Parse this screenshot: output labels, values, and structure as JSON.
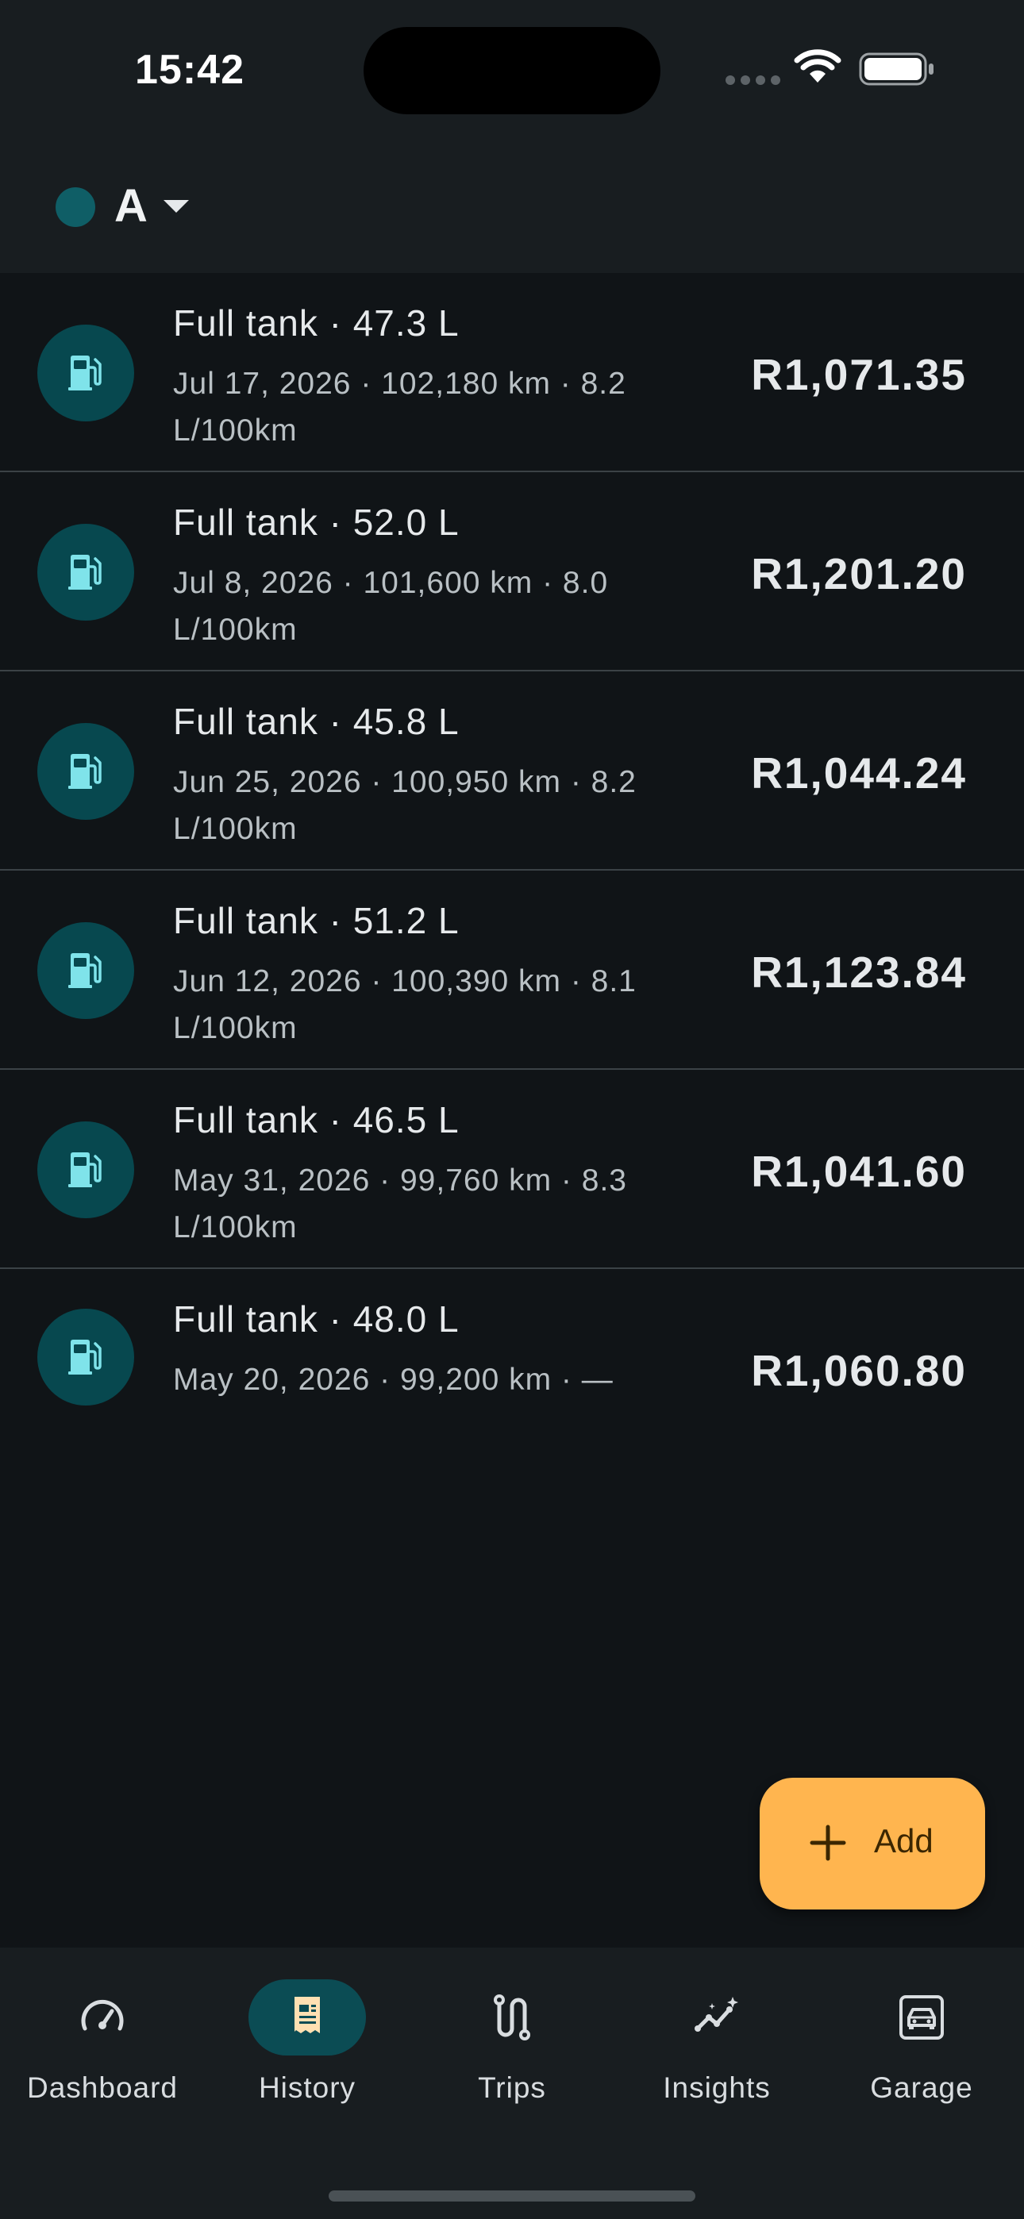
{
  "status_bar": {
    "time": "15:42"
  },
  "header": {
    "vehicle_name": "A"
  },
  "entries": [
    {
      "title": "Full tank · 47.3 L",
      "subtitle": "Jul 17, 2026 · 102,180 km · 8.2 L/100km",
      "amount": "R1,071.35"
    },
    {
      "title": "Full tank · 52.0 L",
      "subtitle": "Jul 8, 2026 · 101,600 km · 8.0 L/100km",
      "amount": "R1,201.20"
    },
    {
      "title": "Full tank · 45.8 L",
      "subtitle": "Jun 25, 2026 · 100,950 km · 8.2 L/100km",
      "amount": "R1,044.24"
    },
    {
      "title": "Full tank · 51.2 L",
      "subtitle": "Jun 12, 2026 · 100,390 km · 8.1 L/100km",
      "amount": "R1,123.84"
    },
    {
      "title": "Full tank · 46.5 L",
      "subtitle": "May 31, 2026 · 99,760 km · 8.3 L/100km",
      "amount": "R1,041.60"
    },
    {
      "title": "Full tank · 48.0 L",
      "subtitle": "May 20, 2026 · 99,200 km · —",
      "amount": "R1,060.80"
    }
  ],
  "fab": {
    "label": "Add"
  },
  "nav": {
    "items": [
      {
        "label": "Dashboard",
        "icon": "speedometer-icon"
      },
      {
        "label": "History",
        "icon": "receipt-icon",
        "active": true
      },
      {
        "label": "Trips",
        "icon": "route-icon"
      },
      {
        "label": "Insights",
        "icon": "insights-icon"
      },
      {
        "label": "Garage",
        "icon": "car-icon"
      }
    ]
  },
  "colors": {
    "background": "#101417",
    "surface": "#181d20",
    "accent_teal": "#07484f",
    "icon_teal": "#7fe3ea",
    "fab": "#ffb54f"
  }
}
